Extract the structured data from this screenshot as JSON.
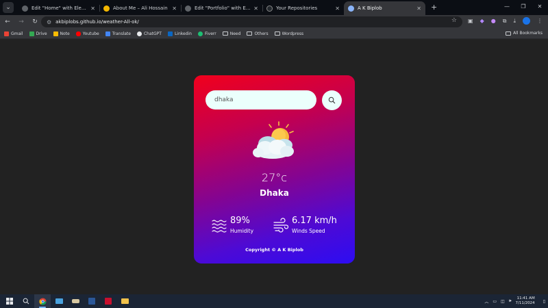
{
  "browser": {
    "tabs": [
      {
        "title": "Edit \"Home\" with Elementor",
        "active": false
      },
      {
        "title": "About Me – Ali Hossain",
        "active": false
      },
      {
        "title": "Edit \"Portfolio\" with Elementor",
        "active": false
      },
      {
        "title": "Your Repositories",
        "active": false
      },
      {
        "title": "A K Biplob",
        "active": true
      }
    ],
    "new_tab": "+",
    "url": "akbiplobs.github.io/weather-All-ok/",
    "bookmarks": [
      "Gmail",
      "Drive",
      "Note",
      "Youtube",
      "Translate",
      "ChatGPT",
      "Linkedin",
      "Fiverr",
      "Need",
      "Others",
      "Wordpress"
    ],
    "all_bookmarks": "All Bookmarks"
  },
  "app": {
    "search_value": "dhaka",
    "temperature": "27°c",
    "city": "Dhaka",
    "humidity_value": "89%",
    "humidity_label": "Humidity",
    "wind_value": "6.17 km/h",
    "wind_label": "Winds Speed",
    "copyright": "Copyright © A K Biplob"
  },
  "taskbar": {
    "time": "11:41 AM",
    "date": "7/11/2024"
  },
  "colors": {
    "card_gradient_top": "#f1001c",
    "card_gradient_bottom": "#2d0cf2",
    "input_bg": "#ebfffc",
    "page_bg": "#222222"
  }
}
